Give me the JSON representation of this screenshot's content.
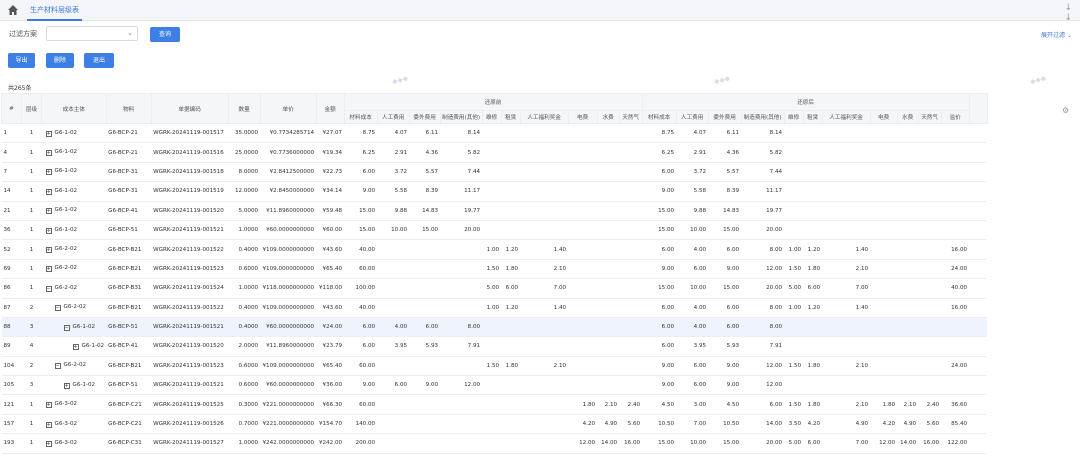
{
  "tab_label": "生产材料层级表",
  "filter": {
    "label": "过滤方案",
    "value": "",
    "query_button": "查询",
    "advanced": "展开过滤"
  },
  "actions": {
    "export": "导出",
    "delete": "删除",
    "exit": "退出"
  },
  "total_label": "共265条",
  "columns": [
    "#",
    "层级",
    "成本主体",
    "物料",
    "单据编码",
    "数量",
    "单价",
    "金额"
  ],
  "group_before": "还原前",
  "group_after": "还原后",
  "sub_before": [
    "材料成本",
    "人工费用",
    "委外费用",
    "制造费用(其他)",
    "维修",
    "租赁",
    "人工福利奖金",
    "电费",
    "水费",
    "天然气"
  ],
  "sub_after": [
    "材料成本",
    "人工费用",
    "委外费用",
    "制造费用(其他)",
    "维修",
    "租赁",
    "人工福利奖金",
    "电费",
    "水费",
    "天然气",
    "溢价"
  ],
  "rows": [
    {
      "idx": "1",
      "lvl": "1",
      "ind": 0,
      "sign": "+",
      "main": "G6-1-02",
      "mat": "G6-BCP-21",
      "doc": "WGRK-20241119-001517",
      "qty": "35.0000",
      "price": "¥0.7734285714",
      "amt": "¥27.07",
      "b": [
        "8.75",
        "4.07",
        "6.11",
        "8.14",
        "",
        "",
        "",
        "",
        "",
        ""
      ],
      "a": [
        "8.75",
        "4.07",
        "6.11",
        "8.14",
        "",
        "",
        "",
        "",
        "",
        "",
        ""
      ]
    },
    {
      "idx": "4",
      "lvl": "1",
      "ind": 0,
      "sign": "+",
      "main": "G6-1-02",
      "mat": "G6-BCP-21",
      "doc": "WGRK-20241119-001516",
      "qty": "25.0000",
      "price": "¥0.7736000000",
      "amt": "¥19.34",
      "b": [
        "6.25",
        "2.91",
        "4.36",
        "5.82",
        "",
        "",
        "",
        "",
        "",
        ""
      ],
      "a": [
        "6.25",
        "2.91",
        "4.36",
        "5.82",
        "",
        "",
        "",
        "",
        "",
        "",
        ""
      ]
    },
    {
      "idx": "7",
      "lvl": "1",
      "ind": 0,
      "sign": "+",
      "main": "G6-1-02",
      "mat": "G6-BCP-31",
      "doc": "WGRK-20241119-001518",
      "qty": "8.0000",
      "price": "¥2.8412500000",
      "amt": "¥22.73",
      "b": [
        "6.00",
        "3.72",
        "5.57",
        "7.44",
        "",
        "",
        "",
        "",
        "",
        ""
      ],
      "a": [
        "6.00",
        "3.72",
        "5.57",
        "7.44",
        "",
        "",
        "",
        "",
        "",
        "",
        ""
      ]
    },
    {
      "idx": "14",
      "lvl": "1",
      "ind": 0,
      "sign": "+",
      "main": "G6-1-02",
      "mat": "G6-BCP-31",
      "doc": "WGRK-20241119-001519",
      "qty": "12.0000",
      "price": "¥2.8450000000",
      "amt": "¥34.14",
      "b": [
        "9.00",
        "5.58",
        "8.39",
        "11.17",
        "",
        "",
        "",
        "",
        "",
        ""
      ],
      "a": [
        "9.00",
        "5.58",
        "8.39",
        "11.17",
        "",
        "",
        "",
        "",
        "",
        "",
        ""
      ]
    },
    {
      "idx": "21",
      "lvl": "1",
      "ind": 0,
      "sign": "+",
      "main": "G6-1-02",
      "mat": "G6-BCP-41",
      "doc": "WGRK-20241119-001520",
      "qty": "5.0000",
      "price": "¥11.8960000000",
      "amt": "¥59.48",
      "b": [
        "15.00",
        "9.88",
        "14.83",
        "19.77",
        "",
        "",
        "",
        "",
        "",
        ""
      ],
      "a": [
        "15.00",
        "9.88",
        "14.83",
        "19.77",
        "",
        "",
        "",
        "",
        "",
        "",
        ""
      ]
    },
    {
      "idx": "36",
      "lvl": "1",
      "ind": 0,
      "sign": "+",
      "main": "G6-1-02",
      "mat": "G6-BCP-51",
      "doc": "WGRK-20241119-001521",
      "qty": "1.0000",
      "price": "¥60.0000000000",
      "amt": "¥60.00",
      "b": [
        "15.00",
        "10.00",
        "15.00",
        "20.00",
        "",
        "",
        "",
        "",
        "",
        ""
      ],
      "a": [
        "15.00",
        "10.00",
        "15.00",
        "20.00",
        "",
        "",
        "",
        "",
        "",
        "",
        ""
      ]
    },
    {
      "idx": "52",
      "lvl": "1",
      "ind": 0,
      "sign": "+",
      "main": "G6-2-02",
      "mat": "G6-BCP-B21",
      "doc": "WGRK-20241119-001522",
      "qty": "0.4000",
      "price": "¥109.0000000000",
      "amt": "¥43.60",
      "b": [
        "40.00",
        "",
        "",
        "",
        "1.00",
        "1.20",
        "1.40",
        "",
        "",
        ""
      ],
      "a": [
        "6.00",
        "4.00",
        "6.00",
        "8.00",
        "1.00",
        "1.20",
        "1.40",
        "",
        "",
        "",
        "16.00"
      ]
    },
    {
      "idx": "69",
      "lvl": "1",
      "ind": 0,
      "sign": "+",
      "main": "G6-2-02",
      "mat": "G6-BCP-B21",
      "doc": "WGRK-20241119-001523",
      "qty": "0.6000",
      "price": "¥109.0000000000",
      "amt": "¥65.40",
      "b": [
        "60.00",
        "",
        "",
        "",
        "1.50",
        "1.80",
        "2.10",
        "",
        "",
        ""
      ],
      "a": [
        "9.00",
        "6.00",
        "9.00",
        "12.00",
        "1.50",
        "1.80",
        "2.10",
        "",
        "",
        "",
        "24.00"
      ]
    },
    {
      "idx": "86",
      "lvl": "1",
      "ind": 0,
      "sign": "−",
      "main": "G6-2-02",
      "mat": "G6-BCP-B31",
      "doc": "WGRK-20241119-001524",
      "qty": "1.0000",
      "price": "¥118.0000000000",
      "amt": "¥118.00",
      "b": [
        "100.00",
        "",
        "",
        "",
        "5.00",
        "6.00",
        "7.00",
        "",
        "",
        ""
      ],
      "a": [
        "15.00",
        "10.00",
        "15.00",
        "20.00",
        "5.00",
        "6.00",
        "7.00",
        "",
        "",
        "",
        "40.00"
      ]
    },
    {
      "idx": "87",
      "lvl": "2",
      "ind": 1,
      "sign": "−",
      "main": "G6-2-02",
      "mat": "G6-BCP-B21",
      "doc": "WGRK-20241119-001522",
      "qty": "0.4000",
      "price": "¥109.0000000000",
      "amt": "¥43.60",
      "b": [
        "40.00",
        "",
        "",
        "",
        "1.00",
        "1.20",
        "1.40",
        "",
        "",
        ""
      ],
      "a": [
        "6.00",
        "4.00",
        "6.00",
        "8.00",
        "1.00",
        "1.20",
        "1.40",
        "",
        "",
        "",
        "16.00"
      ]
    },
    {
      "idx": "88",
      "lvl": "3",
      "ind": 2,
      "sign": "−",
      "main": "G6-1-02",
      "mat": "G6-BCP-51",
      "doc": "WGRK-20241119-001521",
      "qty": "0.4000",
      "price": "¥60.0000000000",
      "amt": "¥24.00",
      "b": [
        "6.00",
        "4.00",
        "6.00",
        "8.00",
        "",
        "",
        "",
        "",
        "",
        ""
      ],
      "a": [
        "6.00",
        "4.00",
        "6.00",
        "8.00",
        "",
        "",
        "",
        "",
        "",
        "",
        ""
      ],
      "hl": true
    },
    {
      "idx": "89",
      "lvl": "4",
      "ind": 3,
      "sign": "+",
      "main": "G6-1-02",
      "mat": "G6-BCP-41",
      "doc": "WGRK-20241119-001520",
      "qty": "2.0000",
      "price": "¥11.8960000000",
      "amt": "¥23.79",
      "b": [
        "6.00",
        "3.95",
        "5.93",
        "7.91",
        "",
        "",
        "",
        "",
        "",
        ""
      ],
      "a": [
        "6.00",
        "3.95",
        "5.93",
        "7.91",
        "",
        "",
        "",
        "",
        "",
        "",
        ""
      ]
    },
    {
      "idx": "104",
      "lvl": "2",
      "ind": 1,
      "sign": "−",
      "main": "G6-2-02",
      "mat": "G6-BCP-B21",
      "doc": "WGRK-20241119-001523",
      "qty": "0.6000",
      "price": "¥109.0000000000",
      "amt": "¥65.40",
      "b": [
        "60.00",
        "",
        "",
        "",
        "1.50",
        "1.80",
        "2.10",
        "",
        "",
        ""
      ],
      "a": [
        "9.00",
        "6.00",
        "9.00",
        "12.00",
        "1.50",
        "1.80",
        "2.10",
        "",
        "",
        "",
        "24.00"
      ]
    },
    {
      "idx": "105",
      "lvl": "3",
      "ind": 2,
      "sign": "+",
      "main": "G6-1-02",
      "mat": "G6-BCP-51",
      "doc": "WGRK-20241119-001521",
      "qty": "0.6000",
      "price": "¥60.0000000000",
      "amt": "¥36.00",
      "b": [
        "9.00",
        "6.00",
        "9.00",
        "12.00",
        "",
        "",
        "",
        "",
        "",
        ""
      ],
      "a": [
        "9.00",
        "6.00",
        "9.00",
        "12.00",
        "",
        "",
        "",
        "",
        "",
        "",
        ""
      ]
    },
    {
      "idx": "121",
      "lvl": "1",
      "ind": 0,
      "sign": "+",
      "main": "G6-3-02",
      "mat": "G6-BCP-C21",
      "doc": "WGRK-20241119-001525",
      "qty": "0.3000",
      "price": "¥221.0000000000",
      "amt": "¥66.30",
      "b": [
        "60.00",
        "",
        "",
        "",
        "",
        "",
        "",
        "1.80",
        "2.10",
        "2.40"
      ],
      "a": [
        "4.50",
        "3.00",
        "4.50",
        "6.00",
        "1.50",
        "1.80",
        "2.10",
        "1.80",
        "2.10",
        "2.40",
        "36.60"
      ]
    },
    {
      "idx": "157",
      "lvl": "1",
      "ind": 0,
      "sign": "+",
      "main": "G6-3-02",
      "mat": "G6-BCP-C21",
      "doc": "WGRK-20241119-001526",
      "qty": "0.7000",
      "price": "¥221.0000000000",
      "amt": "¥154.70",
      "b": [
        "140.00",
        "",
        "",
        "",
        "",
        "",
        "",
        "4.20",
        "4.90",
        "5.60"
      ],
      "a": [
        "10.50",
        "7.00",
        "10.50",
        "14.00",
        "3.50",
        "4.20",
        "4.90",
        "4.20",
        "4.90",
        "5.60",
        "85.40"
      ]
    },
    {
      "idx": "193",
      "lvl": "1",
      "ind": 0,
      "sign": "+",
      "main": "G6-3-02",
      "mat": "G6-BCP-C31",
      "doc": "WGRK-20241119-001527",
      "qty": "1.0000",
      "price": "¥242.0000000000",
      "amt": "¥242.00",
      "b": [
        "200.00",
        "",
        "",
        "",
        "",
        "",
        "",
        "12.00",
        "14.00",
        "16.00"
      ],
      "a": [
        "15.00",
        "10.00",
        "15.00",
        "20.00",
        "5.00",
        "6.00",
        "7.00",
        "12.00",
        "14.00",
        "16.00",
        "122.00"
      ]
    }
  ]
}
